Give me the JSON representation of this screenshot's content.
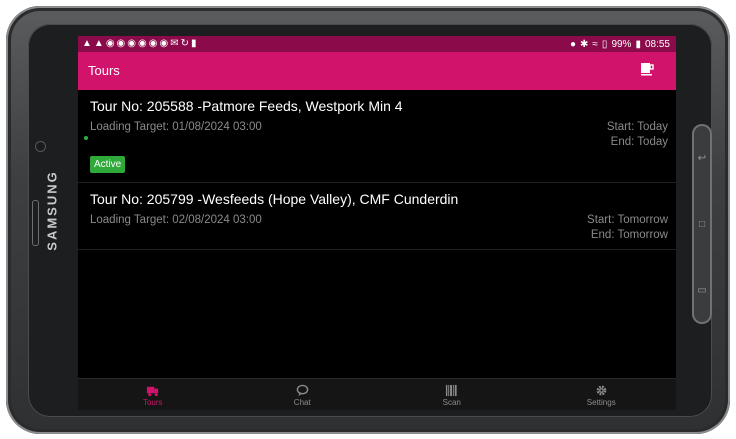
{
  "device": {
    "brand": "SAMSUNG"
  },
  "statusbar": {
    "left_icons": [
      "warning-icon",
      "warning-icon",
      "notification-icon",
      "notification-icon",
      "notification-icon",
      "notification-icon",
      "notification-icon",
      "notification-icon",
      "mail-icon",
      "sync-icon",
      "tool-icon"
    ],
    "right": {
      "battery": "99%",
      "time": "08:55"
    }
  },
  "appbar": {
    "title": "Tours",
    "action_icon": "coffee-cup-icon"
  },
  "colors": {
    "brand": "#d1136b",
    "status": "#8a0a4a",
    "active_badge": "#2fa93a"
  },
  "tours": [
    {
      "title": "Tour No: 205588 -Patmore Feeds, Westpork Min 4",
      "loading_target": "Loading Target: 01/08/2024 03:00",
      "start": "Start: Today",
      "end": "End: Today",
      "badge": "Active"
    },
    {
      "title": "Tour No: 205799 -Wesfeeds (Hope Valley), CMF Cunderdin",
      "loading_target": "Loading Target: 02/08/2024 03:00",
      "start": "Start: Tomorrow",
      "end": "End: Tomorrow"
    }
  ],
  "nav": [
    {
      "label": "Tours",
      "icon": "truck-icon",
      "active": true
    },
    {
      "label": "Chat",
      "icon": "chat-icon",
      "active": false
    },
    {
      "label": "Scan",
      "icon": "barcode-icon",
      "active": false
    },
    {
      "label": "Settings",
      "icon": "gear-icon",
      "active": false
    }
  ]
}
